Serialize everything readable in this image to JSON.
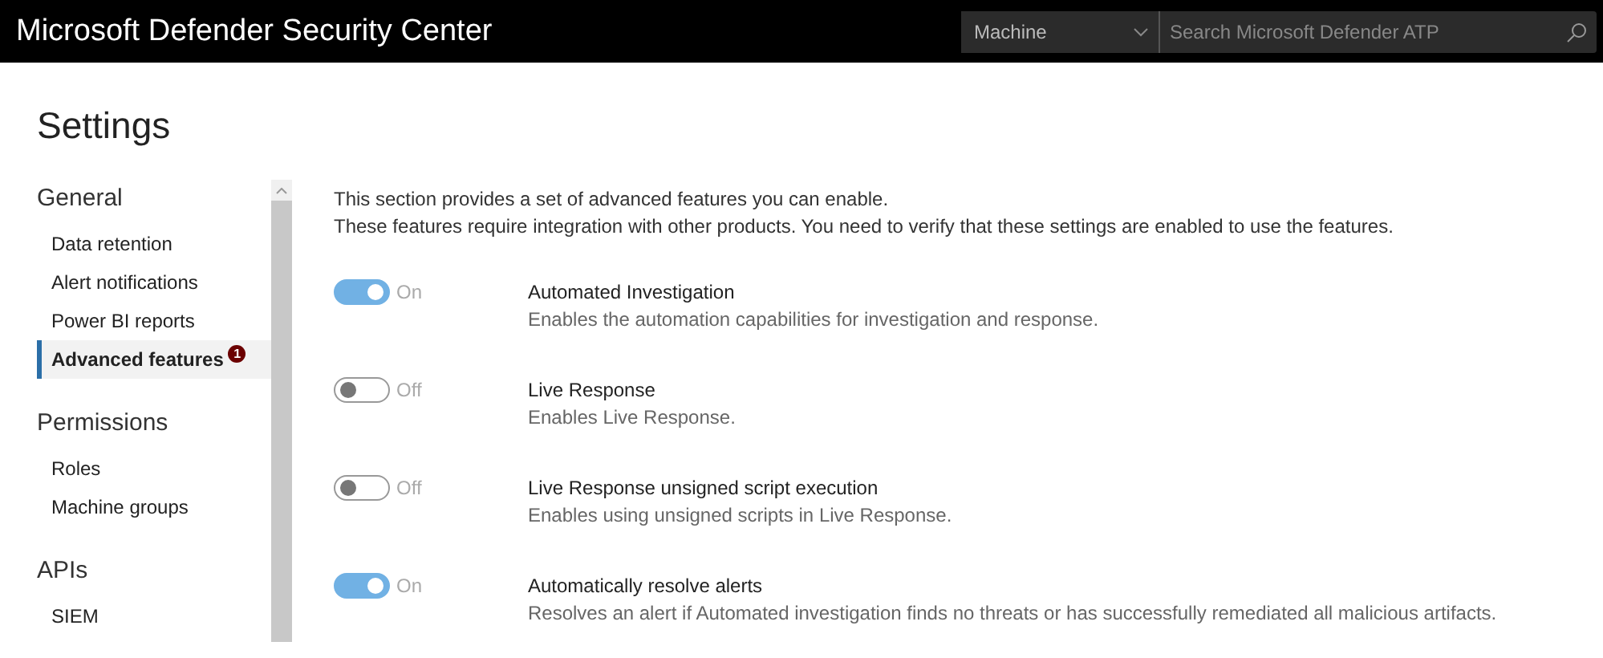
{
  "header": {
    "title": "Microsoft Defender Security Center",
    "scope": "Machine",
    "search": {
      "placeholder": "Search Microsoft Defender ATP"
    }
  },
  "page_title": "Settings",
  "sidebar": {
    "sections": [
      {
        "heading": "General",
        "items": [
          {
            "label": "Data retention",
            "selected": false
          },
          {
            "label": "Alert notifications",
            "selected": false
          },
          {
            "label": "Power BI reports",
            "selected": false
          },
          {
            "label": "Advanced features",
            "selected": true,
            "badge": "1"
          }
        ]
      },
      {
        "heading": "Permissions",
        "items": [
          {
            "label": "Roles",
            "selected": false
          },
          {
            "label": "Machine groups",
            "selected": false
          }
        ]
      },
      {
        "heading": "APIs",
        "items": [
          {
            "label": "SIEM",
            "selected": false
          }
        ]
      }
    ]
  },
  "intro": [
    "This section provides a set of advanced features you can enable.",
    "These features require integration with other products. You need to verify that these settings are enabled to use the features."
  ],
  "features": [
    {
      "on": true,
      "state_label": "On",
      "title": "Automated Investigation",
      "description": "Enables the automation capabilities for investigation and response."
    },
    {
      "on": false,
      "state_label": "Off",
      "title": "Live Response",
      "description": "Enables Live Response."
    },
    {
      "on": false,
      "state_label": "Off",
      "title": "Live Response unsigned script execution",
      "description": "Enables using unsigned scripts in Live Response."
    },
    {
      "on": true,
      "state_label": "On",
      "title": "Automatically resolve alerts",
      "description": "Resolves an alert if Automated investigation finds no threats or has successfully remediated all malicious artifacts."
    }
  ]
}
